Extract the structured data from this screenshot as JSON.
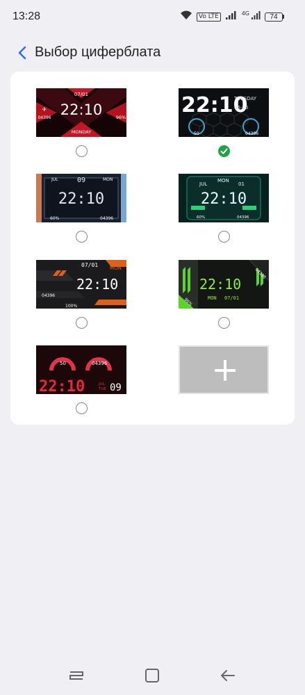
{
  "status_bar": {
    "time": "13:28",
    "volte_label": "Vo LTE",
    "network_label": "4G",
    "battery_level": "74",
    "icons": [
      "wifi-icon",
      "volte-icon",
      "signal-icon",
      "battery-icon"
    ]
  },
  "header": {
    "title": "Выбор циферблата",
    "back_icon": "chevron-left-icon"
  },
  "colors": {
    "accent_blue": "#2f6ef0",
    "selected_green": "#1fa347",
    "card_bg": "#ffffff",
    "page_bg": "#f0f0f4"
  },
  "watch_faces": [
    {
      "id": "face1",
      "selected": false,
      "date": "07/01",
      "time": "22:10",
      "day": "MONDAY",
      "steps": "04396",
      "battery": "96%"
    },
    {
      "id": "face2",
      "selected": true,
      "time": "22:10",
      "day": "TUESDAY",
      "date": "06-26",
      "battery": "50",
      "steps": "04396"
    },
    {
      "id": "face3",
      "selected": false,
      "month": "JUL",
      "date": "09",
      "day": "MON",
      "time": "22:10",
      "battery": "60%",
      "steps": "04396"
    },
    {
      "id": "face4",
      "selected": false,
      "month": "JUL",
      "day": "MON",
      "date": "01",
      "time": "22:10",
      "battery": "60%",
      "steps": "04396"
    },
    {
      "id": "face5",
      "selected": false,
      "date": "07/01",
      "day": "MON",
      "time": "22:10",
      "steps": "04396",
      "battery": "100%"
    },
    {
      "id": "face6",
      "selected": false,
      "steps": "04396",
      "time": "22:10",
      "day": "MON",
      "date": "07/01",
      "battery": "96%"
    },
    {
      "id": "face7",
      "selected": false,
      "battery": "50",
      "steps": "04396",
      "time": "22:10",
      "month": "JUL",
      "day": "TUE",
      "date": "09"
    }
  ],
  "add_tile": {
    "icon": "plus-icon"
  },
  "nav_bar": {
    "icons": [
      "recents-icon",
      "home-icon",
      "back-arrow-icon"
    ]
  }
}
